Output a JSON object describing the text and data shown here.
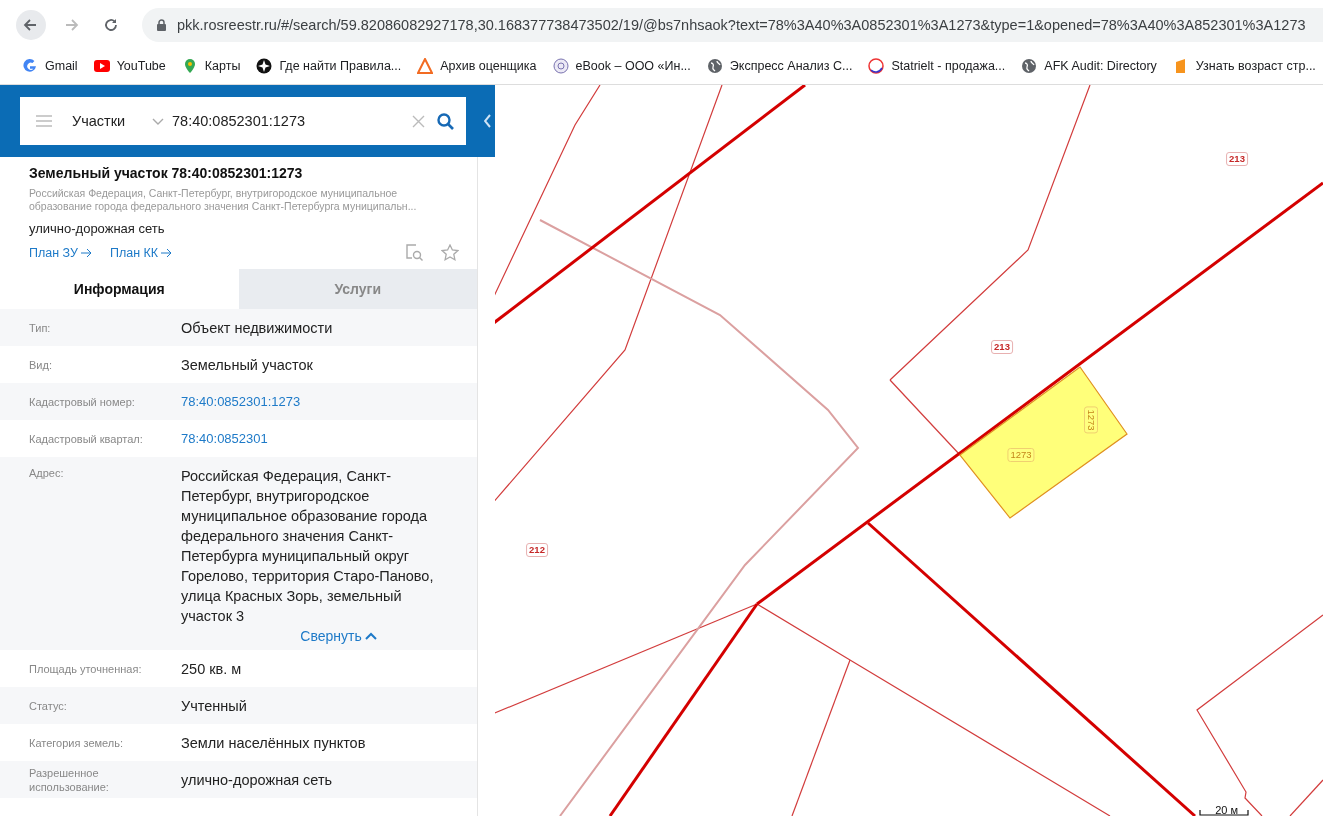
{
  "browser": {
    "url": "pkk.rosreestr.ru/#/search/59.82086082927178,30.168377738473502/19/@bs7nhsaok?text=78%3A40%3A0852301%3A1273&type=1&opened=78%3A40%3A852301%3A1273",
    "bookmarks": [
      {
        "label": "Gmail"
      },
      {
        "label": "YouTube"
      },
      {
        "label": "Карты"
      },
      {
        "label": "Где найти Правила..."
      },
      {
        "label": "Архив оценщика"
      },
      {
        "label": "eBook – ООО «Ин..."
      },
      {
        "label": "Экспресс Анализ С..."
      },
      {
        "label": "Statrielt - продажа..."
      },
      {
        "label": "AFK Audit: Directory"
      },
      {
        "label": "Узнать возраст стр..."
      }
    ]
  },
  "search": {
    "category": "Участки",
    "query": "78:40:0852301:1273"
  },
  "result": {
    "title": "Земельный участок 78:40:0852301:1273",
    "address": "Российская Федерация, Санкт-Петербург, внутригородское муниципальное образование города федерального значения Санкт-Петербурга муниципальн...",
    "purpose": "улично-дорожная сеть",
    "links": [
      {
        "label": "План ЗУ"
      },
      {
        "label": "План КК"
      }
    ]
  },
  "tabs": [
    {
      "label": "Информация",
      "selected": true
    },
    {
      "label": "Услуги",
      "selected": false
    }
  ],
  "attributes": [
    {
      "label": "Тип:",
      "value": "Объект недвижимости",
      "kind": "text"
    },
    {
      "label": "Вид:",
      "value": "Земельный участок",
      "kind": "text"
    },
    {
      "label": "Кадастровый номер:",
      "value": "78:40:0852301:1273",
      "kind": "link"
    },
    {
      "label": "Кадастровый квартал:",
      "value": "78:40:0852301",
      "kind": "link"
    },
    {
      "label": "Адрес:",
      "value": "Российская Федерация, Санкт-Петербург, внутригородское муниципальное образование города федерального значения Санкт-Петербурга муниципальный округ Горелово, территория Старо-Паново, улица Красных Зорь, земельный участок 3",
      "kind": "text",
      "toggle": "Свернуть"
    },
    {
      "label": "Площадь уточненная:",
      "value": "250 кв. м",
      "kind": "text"
    },
    {
      "label": "Статус:",
      "value": "Учтенный",
      "kind": "text"
    },
    {
      "label": "Категория земель:",
      "value": "Земли населённых пунктов",
      "kind": "text"
    },
    {
      "label": "Разрешенное использование:",
      "value": "улично-дорожная сеть",
      "kind": "text"
    }
  ],
  "map": {
    "labels": [
      {
        "text": "213",
        "kind": "parcel"
      },
      {
        "text": "213",
        "kind": "parcel"
      },
      {
        "text": "212",
        "kind": "parcel"
      },
      {
        "text": "1273",
        "kind": "selected"
      },
      {
        "text": "1273",
        "kind": "selected"
      }
    ],
    "scale": "20 м"
  }
}
